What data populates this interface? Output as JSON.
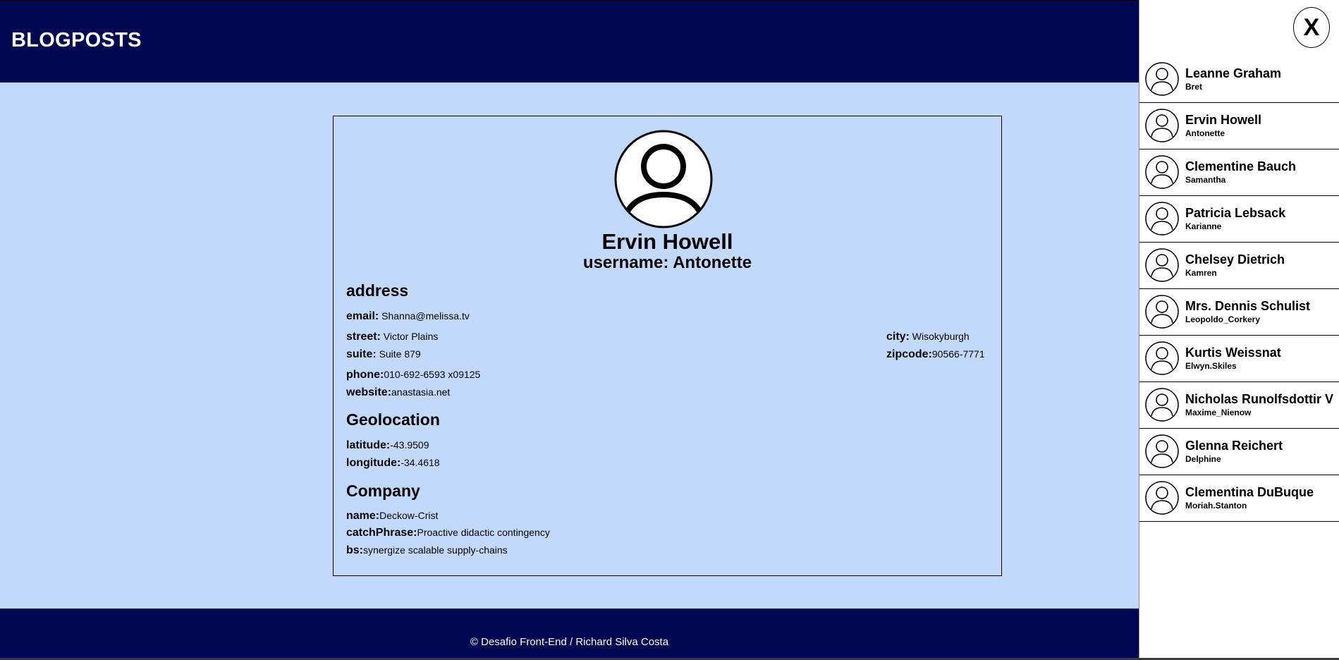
{
  "header": {
    "title": "BLOGPOSTS"
  },
  "colors": {
    "header_bg": "#000852",
    "main_bg": "#c2d9fb",
    "sidebar_bg": "#ffffff"
  },
  "profile": {
    "icon": "user-avatar-icon",
    "name": "Ervin Howell",
    "username_line": "username: Antonette",
    "address": {
      "title": "address",
      "email_label": "email:",
      "email": "Shanna@melissa.tv",
      "street_label": "street:",
      "street": "Victor Plains",
      "suite_label": "suite:",
      "suite": "Suite 879",
      "city_label": "city:",
      "city": "Wisokyburgh",
      "zipcode_label": "zipcode:",
      "zipcode": "90566-7771",
      "phone_label": "phone:",
      "phone": "010-692-6593 x09125",
      "website_label": "website:",
      "website": "anastasia.net"
    },
    "geo": {
      "title": "Geolocation",
      "lat_label": "latitude:",
      "lat": "-43.9509",
      "lng_label": "longitude:",
      "lng": "-34.4618"
    },
    "company": {
      "title": "Company",
      "name_label": "name:",
      "name": "Deckow-Crist",
      "catch_label": "catchPhrase:",
      "catch": "Proactive didactic contingency",
      "bs_label": "bs:",
      "bs": "synergize scalable supply-chains"
    }
  },
  "sidebar": {
    "close_label": "X",
    "users": [
      {
        "name": "Leanne Graham",
        "username": "Bret"
      },
      {
        "name": "Ervin Howell",
        "username": "Antonette"
      },
      {
        "name": "Clementine Bauch",
        "username": "Samantha"
      },
      {
        "name": "Patricia Lebsack",
        "username": "Karianne"
      },
      {
        "name": "Chelsey Dietrich",
        "username": "Kamren"
      },
      {
        "name": "Mrs. Dennis Schulist",
        "username": "Leopoldo_Corkery"
      },
      {
        "name": "Kurtis Weissnat",
        "username": "Elwyn.Skiles"
      },
      {
        "name": "Nicholas Runolfsdottir V",
        "username": "Maxime_Nienow"
      },
      {
        "name": "Glenna Reichert",
        "username": "Delphine"
      },
      {
        "name": "Clementina DuBuque",
        "username": "Moriah.Stanton"
      }
    ]
  },
  "footer": {
    "text": "© Desafio Front-End / Richard Silva Costa"
  }
}
